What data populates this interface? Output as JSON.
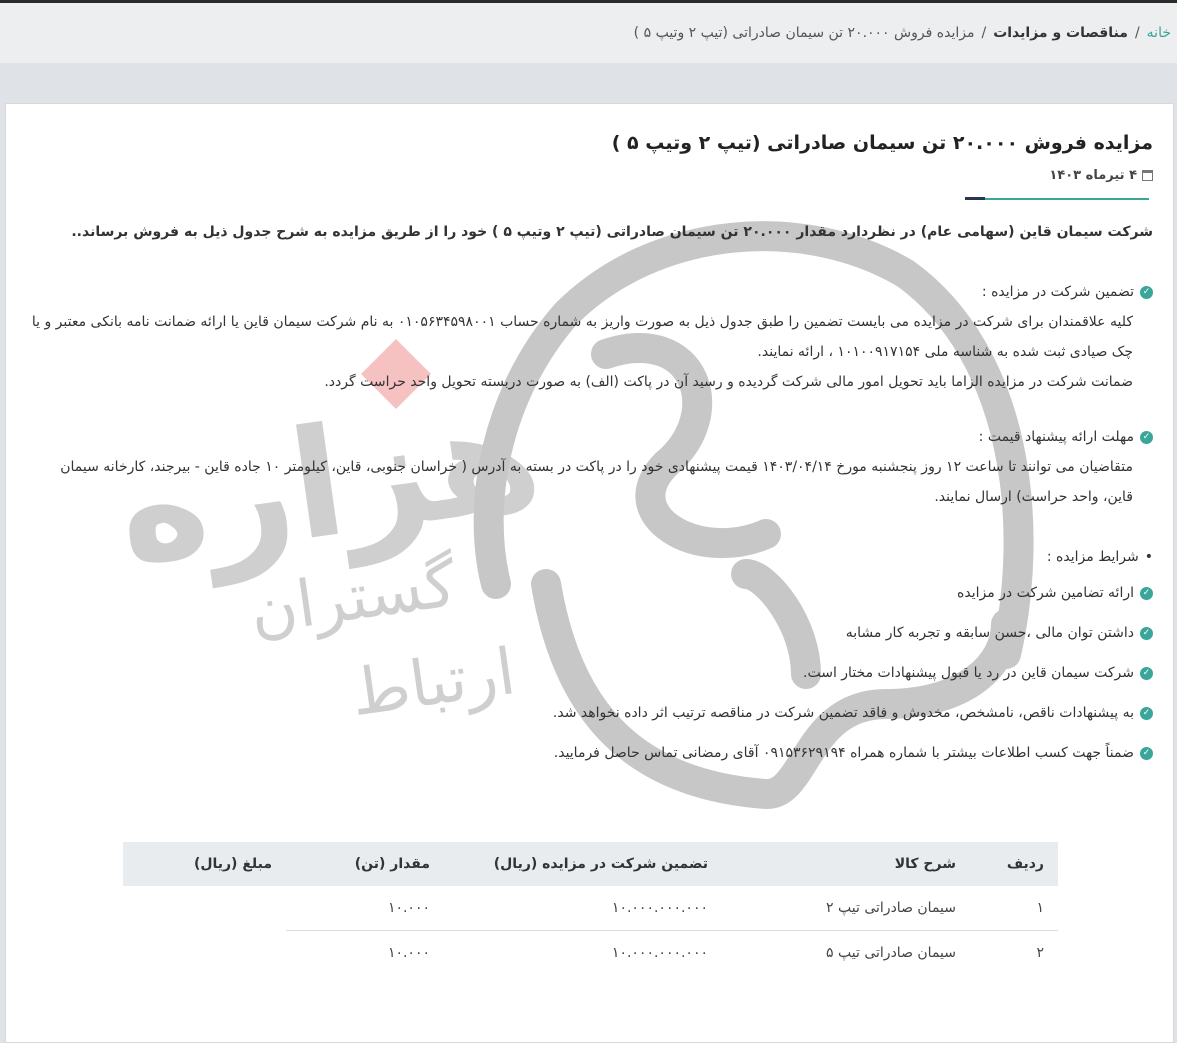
{
  "breadcrumb": {
    "home": "خانه",
    "section": "مناقصات و مزایدات",
    "current": "مزایده فروش ۲۰.۰۰۰ تن سیمان صادراتی (تیپ ۲ وتیپ ۵ )"
  },
  "article": {
    "title": "مزایده فروش ۲۰.۰۰۰ تن سیمان صادراتی (تیپ ۲ وتیپ ۵ )",
    "date": "۴ تیرماه ۱۴۰۳",
    "intro": "شرکت سیمان قاین (سهامی عام) در نظردارد مقدار ۲۰.۰۰۰ تن سیمان صادراتی (تیپ ۲ وتیپ ۵ ) خود را از طریق مزایده به شرح جدول ذیل به فروش برساند..",
    "guarantee": {
      "heading": "تضمین شرکت در مزایده :",
      "lines": [
        "کلیه علاقمندان برای شرکت در مزایده می بایست تضمین را طبق جدول ذیل به صورت واریز به شماره حساب ۰۱۰۵۶۳۴۵۹۸۰۰۱ به نام شرکت سیمان قاین یا ارائه ضمانت نامه بانکی معتبر و یا",
        "چک صیادی ثبت شده به شناسه ملی ۱۰۱۰۰۹۱۷۱۵۴ ، ارائه نمایند.",
        "ضمانت شرکت در مزایده الزاما باید تحویل امور مالی شرکت گردیده و رسید آن در پاکت (الف) به صورت دربسته تحویل واحد حراست گردد."
      ]
    },
    "deadline": {
      "heading": "مهلت ارائه پیشنهاد قیمت :",
      "lines": [
        "متقاضیان می توانند تا ساعت ۱۲ روز پنجشنبه مورخ ۱۴۰۳/۰۴/۱۴ قیمت پیشنهادی خود را در پاکت در بسته به آدرس ( خراسان جنوبی، قاین، کیلومتر ۱۰ جاده قاین - بیرجند، کارخانه سیمان",
        "قاین، واحد حراست) ارسال نمایند."
      ]
    },
    "conditions": {
      "heading": "شرایط مزایده :",
      "items": [
        "ارائه تضامین شرکت در مزایده",
        "داشتن توان مالی ،حسن سابقه و تجربه کار مشابه",
        "شرکت سیمان قاین در رد یا قبول پیشنهادات مختار است.",
        "به پیشنهادات ناقص، نامشخص، مخدوش و فاقد تضمین شرکت در مناقصه ترتیب اثر داده نخواهد شد.",
        "ضمناً جهت کسب اطلاعات بیشتر با شماره همراه ۰۹۱۵۳۶۲۹۱۹۴ آقای رمضانی تماس حاصل فرمایید."
      ]
    }
  },
  "table": {
    "headers": [
      "ردیف",
      "شرح کالا",
      "تضمین شرکت در مزایده (ریال)",
      "مقدار (تن)",
      "مبلغ (ریال)"
    ],
    "rows": [
      [
        "۱",
        "سیمان صادراتی تیپ ۲",
        "۱۰.۰۰۰.۰۰۰.۰۰۰",
        "۱۰.۰۰۰",
        ""
      ],
      [
        "۲",
        "سیمان صادراتی تیپ ۵",
        "۱۰.۰۰۰.۰۰۰.۰۰۰",
        "۱۰.۰۰۰",
        ""
      ]
    ]
  },
  "watermark": {
    "line1": "هزاره",
    "line2": "گستران",
    "line3": "ارتباط"
  },
  "colors": {
    "accent": "#3aa69a",
    "dark_accent": "#2b3550",
    "watermark": "#c7c7c7",
    "watermark_diamond": "#f4b6b6"
  },
  "icons": {
    "date": "calendar-icon",
    "bullet": "check-circle-icon"
  }
}
